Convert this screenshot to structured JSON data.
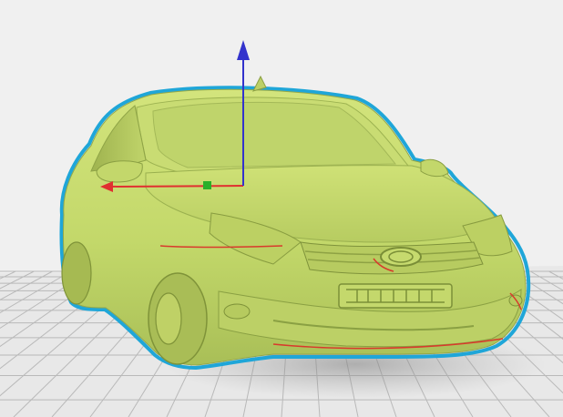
{
  "viewport": {
    "label": "",
    "background_color": "#f0f0f0",
    "model_color": "#c8dd6e",
    "outline_color": "#1fa6d8",
    "grid_color": "#b8b8b8",
    "floor_color": "#e6e6e6"
  },
  "gizmo": {
    "x_axis_color": "#e03030",
    "y_axis_color": "#2ab02a",
    "z_axis_color": "#3333cc"
  },
  "model": {
    "name": "",
    "icon": "car-model-icon",
    "plate_text": ""
  }
}
